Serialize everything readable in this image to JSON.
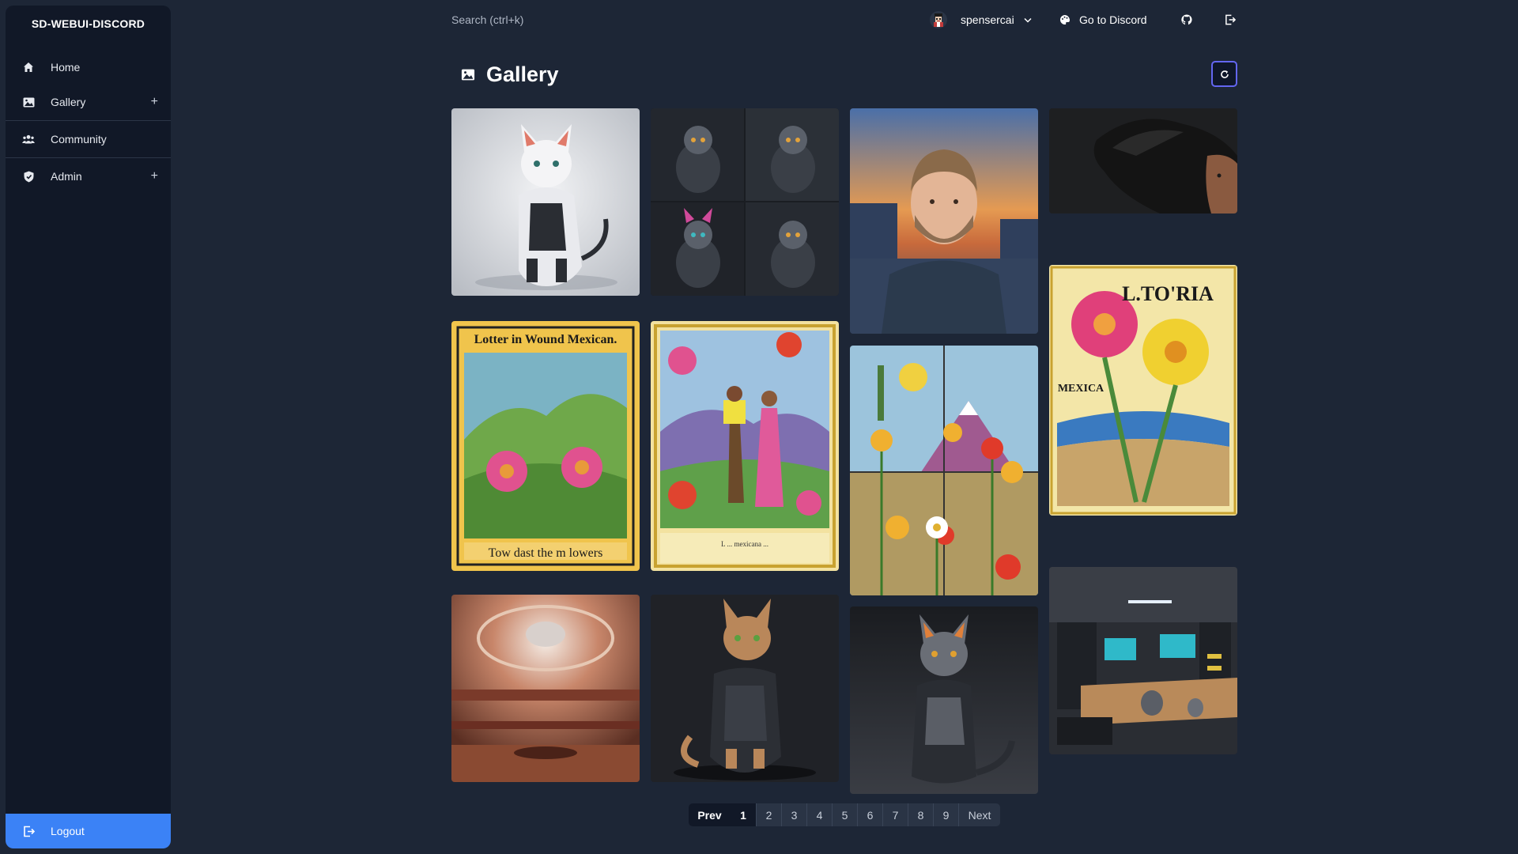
{
  "app": {
    "brand": "SD-WEBUI-DISCORD"
  },
  "sidebar": {
    "items": [
      {
        "label": "Home",
        "icon": "home-icon",
        "expandable": false
      },
      {
        "label": "Gallery",
        "icon": "image-icon",
        "expandable": true
      },
      {
        "label": "Community",
        "icon": "users-icon",
        "expandable": false
      },
      {
        "label": "Admin",
        "icon": "shield-icon",
        "expandable": true
      }
    ],
    "logout_label": "Logout"
  },
  "topbar": {
    "search_placeholder": "Search (ctrl+k)",
    "username": "spensercai",
    "discord_label": "Go to Discord",
    "icons": [
      "github-icon",
      "logout-icon"
    ]
  },
  "gallery": {
    "title": "Gallery",
    "images": [
      {
        "subject": "white robotic cat on grey background"
      },
      {
        "subject": "grid of four dark robotic cats"
      },
      {
        "subject": "bearded man in hoodie at sunset city"
      },
      {
        "subject": "woman with flowing dark hair"
      },
      {
        "subject": "loteria card with pink flowers",
        "caption_top": "Lotter in Wound Mexican.",
        "caption_bottom": "Tow dast the m lowers"
      },
      {
        "subject": "loteria card with dancing couple",
        "caption_bottom": "L ... mexicana ... "
      },
      {
        "subject": "flowers with volcano and cactus"
      },
      {
        "subject": "loteria poster with pink and yellow flowers",
        "caption_top": "L.TO'RIA",
        "caption_side": "MEXICA"
      },
      {
        "subject": "futuristic domed interior"
      },
      {
        "subject": "tabby cyborg cat"
      },
      {
        "subject": "grey robotic cat"
      },
      {
        "subject": "sci-fi workshop with cats"
      }
    ]
  },
  "pagination": {
    "prev_label": "Prev",
    "next_label": "Next",
    "pages": [
      "1",
      "2",
      "3",
      "4",
      "5",
      "6",
      "7",
      "8",
      "9"
    ],
    "current": "1"
  },
  "colors": {
    "background": "#1d2636",
    "sidebar": "#111827",
    "accent": "#3b82f6",
    "refresh_border": "#6366f1"
  }
}
